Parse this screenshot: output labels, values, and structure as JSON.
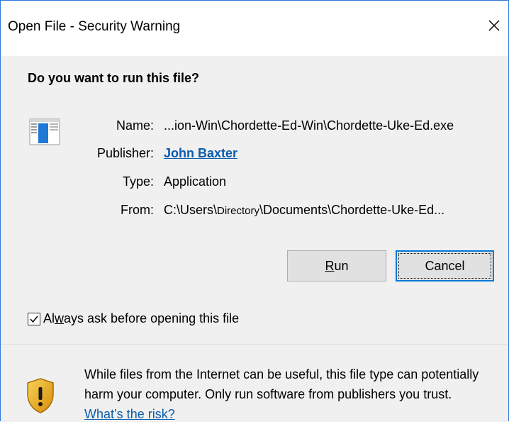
{
  "window": {
    "title": "Open File - Security Warning",
    "close_glyph": "✕"
  },
  "prompt": {
    "question": "Do you want to run this file?"
  },
  "file_info": {
    "name_label": "Name:",
    "name_value": "...ion-Win\\Chordette-Ed-Win\\Chordette-Uke-Ed.exe",
    "publisher_label": "Publisher:",
    "publisher_value": "John Baxter",
    "type_label": "Type:",
    "type_value": "Application",
    "from_label": "From:",
    "from_prefix": "C:\\Users\\",
    "from_dir": "Directory",
    "from_suffix": "\\Documents\\Chordette-Uke-Ed..."
  },
  "buttons": {
    "run_accel": "R",
    "run_rest": "un",
    "cancel": "Cancel"
  },
  "always_ask": {
    "checked": true,
    "text_pre": "Al",
    "text_accel": "w",
    "text_post": "ays ask before opening this file"
  },
  "warning": {
    "text": "While files from the Internet can be useful, this file type can potentially harm your computer. Only run software from publishers you trust. ",
    "link": "What’s the risk?"
  },
  "icons": {
    "file": "application-window-icon",
    "shield": "warning-shield-icon",
    "close": "close-icon",
    "check": "checkmark-icon"
  },
  "colors": {
    "accent": "#0078d7",
    "link": "#0b5cad",
    "window_border": "#2b79d8",
    "dialog_bg": "#f0f0f0",
    "shield_gold": "#e8a317"
  }
}
